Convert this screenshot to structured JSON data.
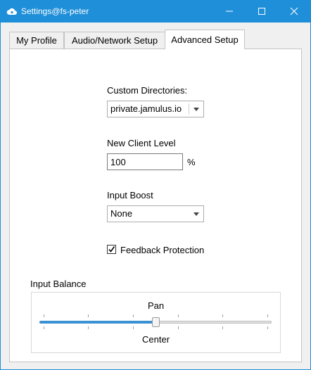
{
  "window": {
    "title": "Settings@fs-peter",
    "icon": "jamulus-cloud-icon"
  },
  "tabs": [
    {
      "label": "My Profile",
      "selected": false
    },
    {
      "label": "Audio/Network Setup",
      "selected": false
    },
    {
      "label": "Advanced Setup",
      "selected": true
    }
  ],
  "advanced": {
    "custom_directories": {
      "label": "Custom Directories:",
      "value": "private.jamulus.io"
    },
    "new_client_level": {
      "label": "New Client Level",
      "value": "100",
      "unit": "%"
    },
    "input_boost": {
      "label": "Input Boost",
      "value": "None"
    },
    "feedback_protection": {
      "label": "Feedback Protection",
      "checked": true
    },
    "input_balance": {
      "label": "Input Balance",
      "top_label": "Pan",
      "bottom_label": "Center",
      "position": 0.5
    }
  },
  "colors": {
    "titlebar": "#1e8fd8",
    "slider_fill": "#3c91d2"
  }
}
